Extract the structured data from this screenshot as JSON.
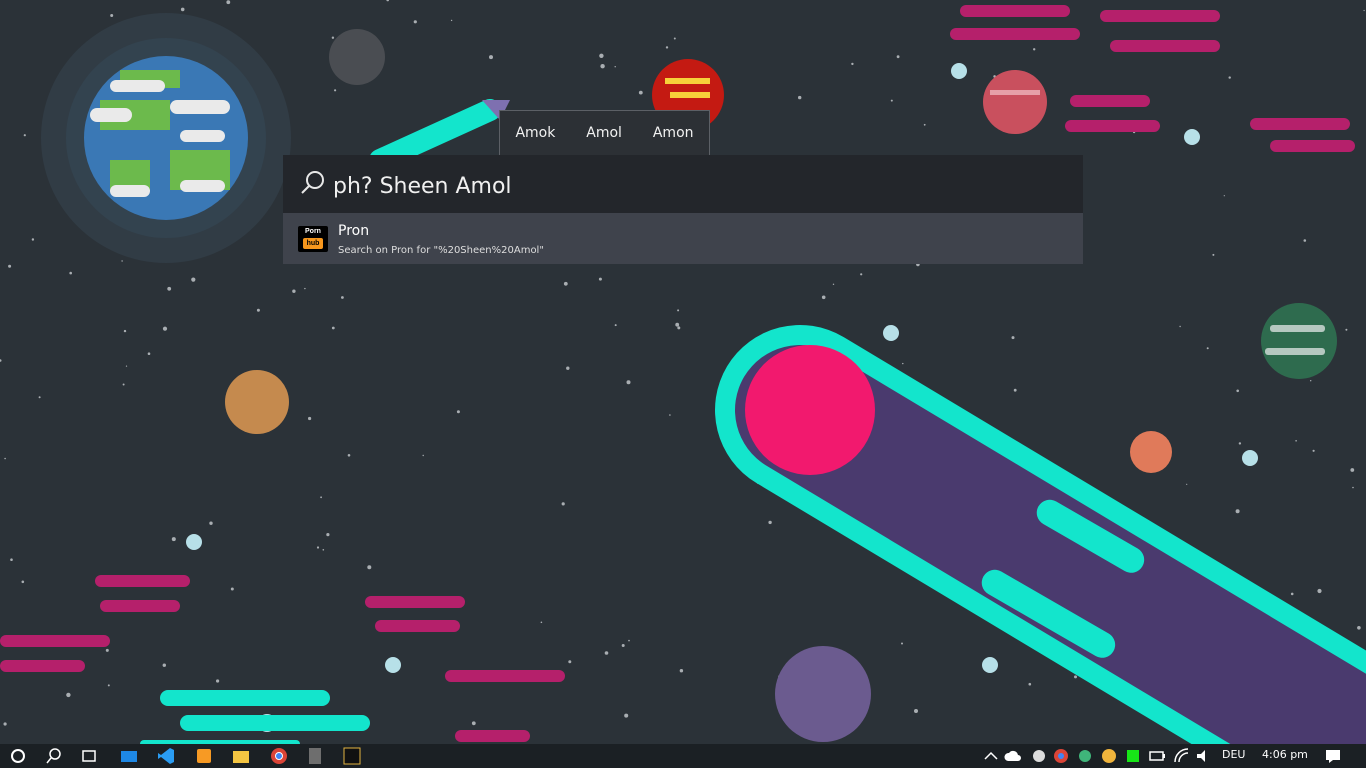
{
  "colors": {
    "sky": "#2b3238",
    "comet_tail": "#13e5cc",
    "comet_head": "#f2196e",
    "launcher_bg": "#23262b",
    "result_bg": "#3f434c",
    "brand_orange": "#f7971d"
  },
  "launcher": {
    "suggestions": [
      "Amok",
      "Amol",
      "Amon"
    ],
    "query": "ph? Sheen Amol",
    "search_icon": "search-icon",
    "results": [
      {
        "title": "Pron",
        "subtitle": "Search on Pron for \"%20Sheen%20Amol\"",
        "logo_top": "Porn",
        "logo_bottom": "hub"
      }
    ]
  },
  "taskbar": {
    "icons": [
      "start-icon",
      "search-icon",
      "task-view-icon",
      "mail-icon",
      "vscode-icon",
      "sublime-icon",
      "file-explorer-icon",
      "chrome-icon",
      "calculator-icon",
      "terminal-icon"
    ],
    "tray": {
      "language": "DEU",
      "time": "4:06 pm"
    }
  }
}
